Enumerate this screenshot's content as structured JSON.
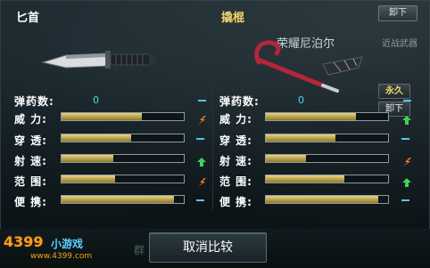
{
  "left_weapon": {
    "name": "匕首"
  },
  "right_weapon": {
    "name": "撬棍",
    "title": "荣耀尼泊尔",
    "type": "近战武器"
  },
  "buttons": {
    "unload_top": "卸下",
    "permanent": "永久",
    "unload_side": "卸下",
    "cancel_compare": "取消比较"
  },
  "bottom": {
    "group_label": "群"
  },
  "watermark": {
    "brand": "4399",
    "sub": "小游戏",
    "url": "www.4399.com"
  },
  "colors": {
    "bar_fill": "#c8b35a",
    "value_text": "#53d6e8",
    "title_gold": "#f0d36a",
    "arrow_up": "#3fd257",
    "arrow_down": "#ff7a1a",
    "dash": "#5cc3ec"
  },
  "stats": {
    "ammo_label": "弹药数:",
    "labels": [
      "威  力:",
      "穿  透:",
      "射  速:",
      "范  围:",
      "便  携:"
    ],
    "left": {
      "ammo": "0",
      "levels": [
        0.66,
        0.57,
        0.42,
        0.44,
        0.92
      ],
      "indicators": [
        "down-arrow-icon",
        "dash-icon",
        "up-arrow-icon",
        "down-arrow-icon",
        "dash-icon"
      ]
    },
    "right": {
      "ammo": "0",
      "levels": [
        0.74,
        0.57,
        0.33,
        0.64,
        0.92
      ],
      "indicators": [
        "up-arrow-icon",
        "dash-icon",
        "down-arrow-icon",
        "up-arrow-icon",
        "dash-icon"
      ]
    }
  }
}
